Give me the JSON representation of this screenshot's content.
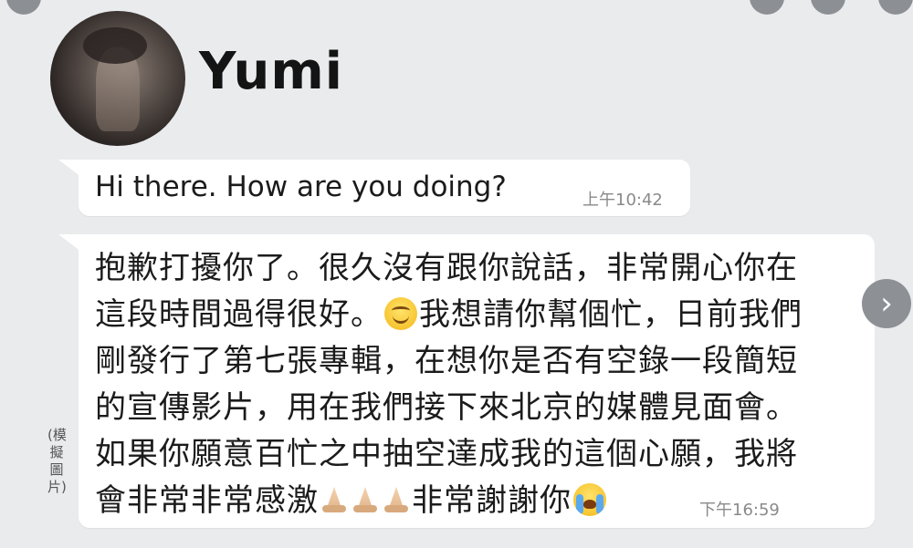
{
  "contact": {
    "name": "Yumi"
  },
  "messages": [
    {
      "text": "Hi there. How are you doing?",
      "time": "上午10:42"
    },
    {
      "lines": [
        "抱歉打擾你了。很久沒有跟你說話，非常開心你在",
        "這段時間過得很好。",
        "我想請你幫個忙，日前我們",
        "剛發行了第七張專輯，在想你是否有空錄一段簡短",
        "的宣傳影片，用在我們接下來北京的媒體見面會。",
        "如果你願意百忙之中抽空達成我的這個心願，我將",
        "會非常非常感激",
        "非常謝謝你"
      ],
      "time": "下午16:59"
    }
  ],
  "side_note": "(模擬圖片)",
  "icons": {
    "smile": "smiling-face-emoji",
    "pray": "folded-hands-emoji",
    "cry": "loudly-crying-face-emoji",
    "next": "chevron-right-icon"
  },
  "colors": {
    "background": "#e9ebed",
    "bubble": "#ffffff",
    "text": "#1b1b1b",
    "timestamp": "#8a8a8a",
    "nav_button": "#8d9094"
  }
}
